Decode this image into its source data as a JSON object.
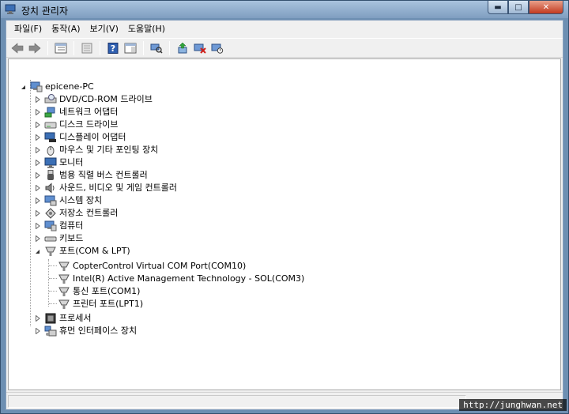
{
  "window": {
    "title": "장치 관리자",
    "caption": {
      "minimize": "▬",
      "maximize": "□",
      "close": "✕"
    }
  },
  "menu": [
    {
      "label": "파일(F)"
    },
    {
      "label": "동작(A)"
    },
    {
      "label": "보기(V)"
    },
    {
      "label": "도움말(H)"
    }
  ],
  "toolbar": {
    "icons": [
      "back-icon",
      "forward-icon",
      "properties-list-icon",
      "gray-list-icon",
      "help-icon",
      "console-pane-icon",
      "scan-hardware-icon",
      "update-driver-icon",
      "uninstall-icon",
      "disable-icon"
    ]
  },
  "tree": {
    "root": {
      "label": "epicene-PC",
      "icon": "computer-icon"
    },
    "categories": [
      {
        "label": "DVD/CD-ROM 드라이브",
        "icon": "dvd-drive-icon"
      },
      {
        "label": "네트워크 어댑터",
        "icon": "network-adapter-icon"
      },
      {
        "label": "디스크 드라이브",
        "icon": "disk-drive-icon"
      },
      {
        "label": "디스플레이 어댑터",
        "icon": "display-adapter-icon"
      },
      {
        "label": "마우스 및 기타 포인팅 장치",
        "icon": "mouse-icon"
      },
      {
        "label": "모니터",
        "icon": "monitor-icon"
      },
      {
        "label": "범용 직렬 버스 컨트롤러",
        "icon": "usb-icon"
      },
      {
        "label": "사운드, 비디오 및 게임 컨트롤러",
        "icon": "sound-icon"
      },
      {
        "label": "시스템 장치",
        "icon": "system-devices-icon"
      },
      {
        "label": "저장소 컨트롤러",
        "icon": "storage-controller-icon"
      },
      {
        "label": "컴퓨터",
        "icon": "computer-icon"
      },
      {
        "label": "키보드",
        "icon": "keyboard-icon"
      },
      {
        "label": "포트(COM & LPT)",
        "icon": "port-icon",
        "expanded": true,
        "children": [
          {
            "label": "CopterControl Virtual COM Port(COM10)"
          },
          {
            "label": "Intel(R) Active Management Technology - SOL(COM3)"
          },
          {
            "label": "통신 포트(COM1)"
          },
          {
            "label": "프린터 포트(LPT1)"
          }
        ]
      },
      {
        "label": "프로세서",
        "icon": "processor-icon"
      },
      {
        "label": "휴먼 인터페이스 장치",
        "icon": "hid-icon"
      }
    ]
  },
  "watermark": "http://junghwan.net"
}
